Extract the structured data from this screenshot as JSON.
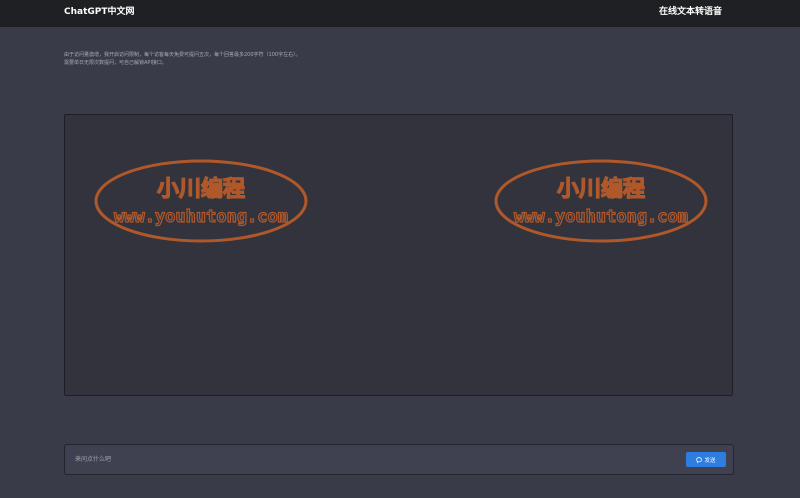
{
  "header": {
    "brand": "ChatGPT中文网",
    "nav_link": "在线文本转语音"
  },
  "notice": {
    "line1": "由于访问量激增，我开启访问限制，每个访客每天免费可提问五次，每个回答最多200字符（100字左右）。",
    "line2": "需要单日无限次数提问，可自己解锁API接口。"
  },
  "watermark": {
    "title": "小川编程",
    "url": "www.youhutong.com",
    "color": "#b0582a"
  },
  "input": {
    "placeholder": "来问点什么吧",
    "value": ""
  },
  "send_button": {
    "label": "发送",
    "color": "#2f7de1"
  },
  "icons": {
    "send": "chat-bubble-icon"
  }
}
